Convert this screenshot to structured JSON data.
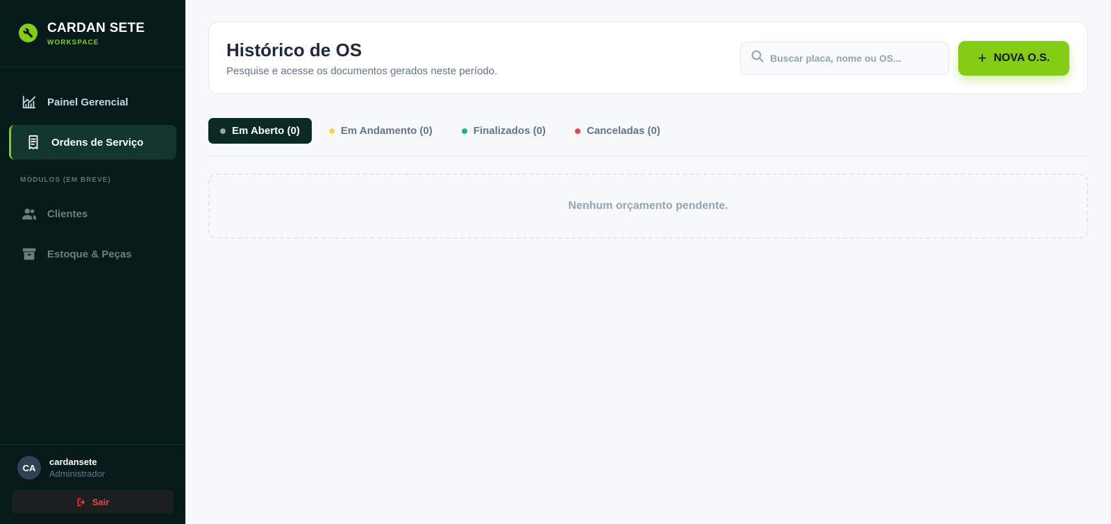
{
  "brand": {
    "title": "CARDAN SETE",
    "subtitle": "WORKSPACE",
    "accent": "#84cc16"
  },
  "sidebar": {
    "items": [
      {
        "label": "Painel Gerencial",
        "icon": "chart-line-icon"
      },
      {
        "label": "Ordens de Serviço",
        "icon": "receipt-icon",
        "active": true
      }
    ],
    "section_label": "MÓDULOS (EM BREVE)",
    "soon_items": [
      {
        "label": "Clientes",
        "icon": "users-icon"
      },
      {
        "label": "Estoque & Peças",
        "icon": "archive-box-icon"
      }
    ]
  },
  "user": {
    "initials": "CA",
    "name": "cardansete",
    "role": "Administrador"
  },
  "logout": {
    "label": "Sair",
    "icon": "logout-icon"
  },
  "header": {
    "title": "Histórico de OS",
    "subtitle": "Pesquise e acesse os documentos gerados neste período.",
    "search_placeholder": "Buscar placa, nome ou OS...",
    "new_button": "NOVA O.S."
  },
  "tabs": [
    {
      "label": "Em Aberto (0)",
      "dot_color": "#94a3b8",
      "active": true
    },
    {
      "label": "Em Andamento (0)",
      "dot_color": "#fcd34d"
    },
    {
      "label": "Finalizados (0)",
      "dot_color": "#10b981"
    },
    {
      "label": "Canceladas (0)",
      "dot_color": "#ef4444"
    }
  ],
  "empty_message": "Nenhum orçamento pendente."
}
